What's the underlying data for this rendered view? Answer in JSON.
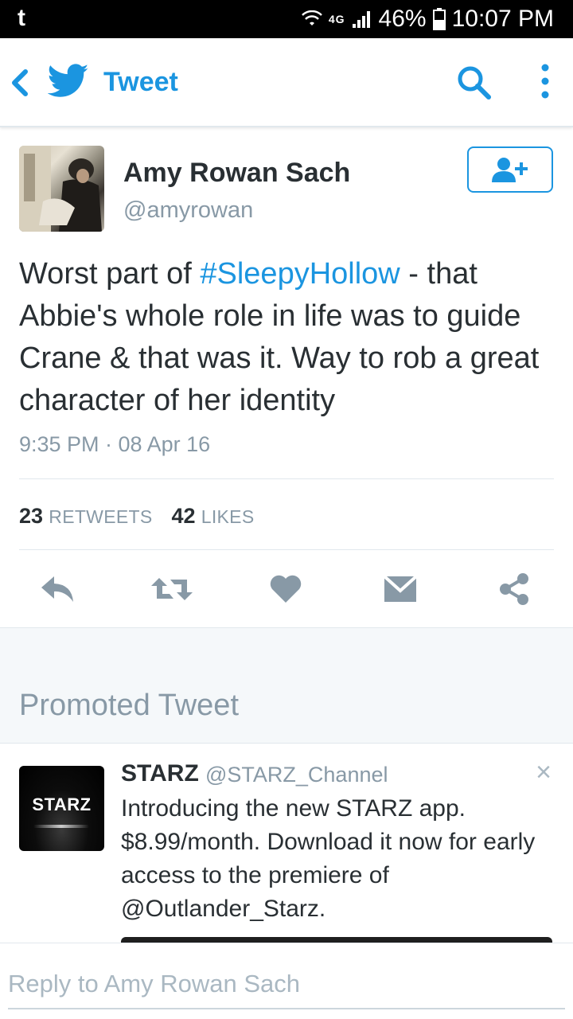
{
  "status_bar": {
    "app_icon": "t",
    "network": "4G",
    "battery": "46%",
    "time": "10:07 PM"
  },
  "app_bar": {
    "title": "Tweet",
    "icons": [
      "back-icon",
      "twitter-bird-icon",
      "search-icon",
      "more-vert-icon"
    ]
  },
  "tweet": {
    "author_name": "Amy Rowan Sach",
    "author_handle": "@amyrowan",
    "text_before": "Worst part of ",
    "hashtag": "#SleepyHollow",
    "text_after": " - that Abbie's whole role in life was to guide Crane & that was it. Way to rob a great character of her identity",
    "timestamp": "9:35 PM · 08 Apr 16",
    "retweet_count": "23",
    "retweet_label": "RETWEETS",
    "like_count": "42",
    "like_label": "LIKES",
    "action_icons": [
      "reply-icon",
      "retweet-icon",
      "heart-icon",
      "dm-icon",
      "share-icon"
    ]
  },
  "promoted": {
    "heading": "Promoted Tweet",
    "logo_text": "STARZ",
    "name": "STARZ",
    "handle": "@STARZ_Channel",
    "text": "Introducing the new STARZ app. $8.99/month. Download it now for early access to the premiere of @Outlander_Starz.",
    "close": "×"
  },
  "reply": {
    "placeholder": "Reply to Amy Rowan Sach"
  },
  "colors": {
    "accent": "#1b95e0",
    "muted": "#8899a6",
    "icon_gray": "#8899a6",
    "text": "#292f33"
  }
}
